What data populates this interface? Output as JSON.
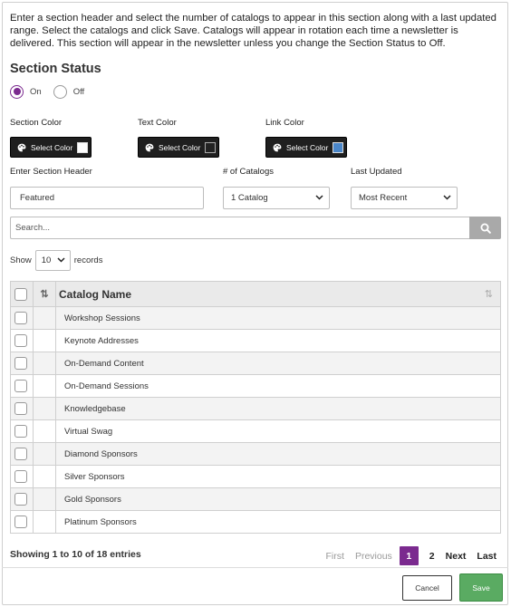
{
  "intro_text": "Enter a section header and select the number of catalogs to appear in this section along with a last updated range. Select the catalogs and click Save. Catalogs will appear in rotation each time a newsletter is delivered. This section will appear in the newsletter unless you change the Section Status to Off.",
  "section_status": {
    "title": "Section Status",
    "options": [
      {
        "label": "On",
        "checked": true
      },
      {
        "label": "Off",
        "checked": false
      }
    ]
  },
  "colors": {
    "section": {
      "label": "Section Color",
      "button": "Select Color",
      "swatch": "#ffffff"
    },
    "text": {
      "label": "Text Color",
      "button": "Select Color",
      "swatch": "#222222"
    },
    "link": {
      "label": "Link Color",
      "button": "Select Color",
      "swatch": "#4a86c8"
    }
  },
  "form": {
    "header_label": "Enter Section Header",
    "header_value": "Featured",
    "catalogs_label": "# of Catalogs",
    "catalogs_value": "1 Catalog",
    "updated_label": "Last Updated",
    "updated_value": "Most Recent"
  },
  "search": {
    "placeholder": "Search..."
  },
  "length": {
    "show": "Show",
    "value": "10",
    "records": "records"
  },
  "table": {
    "column": "Catalog Name",
    "rows": [
      "Workshop Sessions",
      "Keynote Addresses",
      "On-Demand Content",
      "On-Demand Sessions",
      "Knowledgebase",
      "Virtual Swag",
      "Diamond Sponsors",
      "Silver Sponsors",
      "Gold Sponsors",
      "Platinum Sponsors"
    ]
  },
  "info": "Showing 1 to 10 of 18 entries",
  "pagination": {
    "first": "First",
    "previous": "Previous",
    "page1": "1",
    "page2": "2",
    "next": "Next",
    "last": "Last"
  },
  "actions": {
    "cancel": "Cancel",
    "save": "Save"
  },
  "theme": {
    "accent": "#7b2a8f",
    "save_green": "#5aab62",
    "search_button": "#a9a9a9"
  }
}
